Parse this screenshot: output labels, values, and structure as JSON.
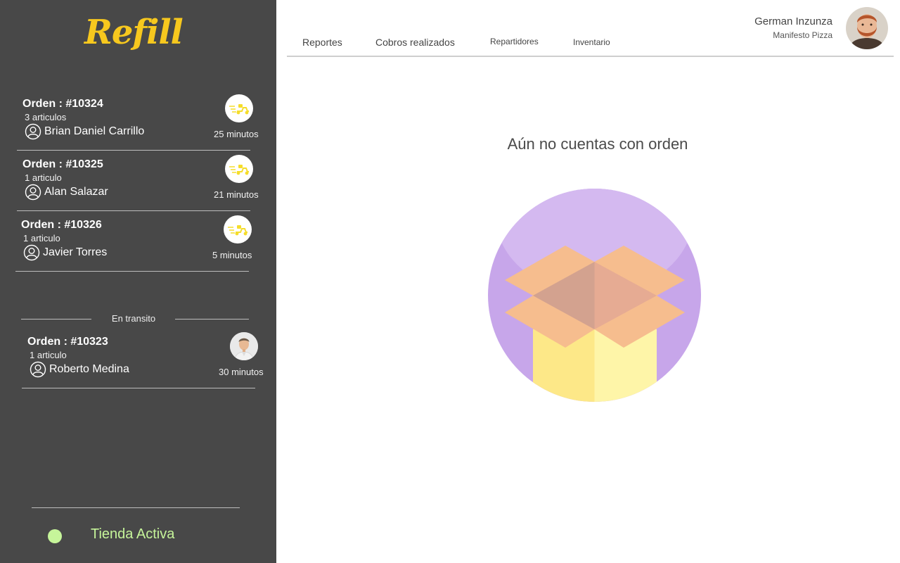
{
  "app": {
    "logo_text": "Refill",
    "brand_color": "#f7c81e"
  },
  "sidebar": {
    "pending_orders": [
      {
        "title": "Orden : #10324",
        "items": "3 articulos",
        "customer": "Brian Daniel Carrillo",
        "time": "25 minutos",
        "badge_icon": "delivery-scooter-icon"
      },
      {
        "title": "Orden : #10325",
        "items": "1 articulo",
        "customer": "Alan Salazar",
        "time": "21 minutos",
        "badge_icon": "delivery-scooter-icon"
      },
      {
        "title": "Orden : #10326",
        "items": "1 articulo",
        "customer": "Javier Torres",
        "time": "5 minutos",
        "badge_icon": "delivery-scooter-icon"
      }
    ],
    "transit_label": "En transito",
    "transit_orders": [
      {
        "title": "Orden : #10323",
        "items": "1 articulo",
        "customer": "Roberto Medina",
        "time": "30 minutos",
        "badge_icon": "courier-avatar"
      }
    ],
    "store_status": {
      "label": "Tienda Activa",
      "color": "#c6f59a"
    }
  },
  "nav": {
    "tabs": [
      {
        "label": "Reportes"
      },
      {
        "label": "Cobros realizados"
      },
      {
        "label": "Repartidores"
      },
      {
        "label": "Inventario"
      }
    ]
  },
  "user": {
    "name": "German Inzunza",
    "store": "Manifesto Pizza"
  },
  "main": {
    "empty_message": "Aún no cuentas con orden",
    "illustration": "empty-box-illustration"
  }
}
